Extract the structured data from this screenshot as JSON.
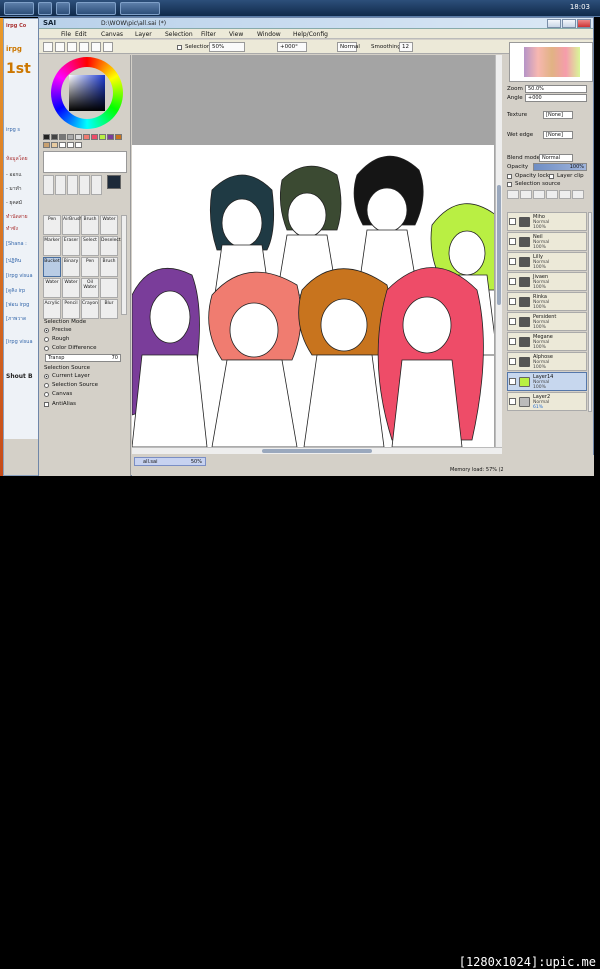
{
  "taskbar": {
    "clock": "18:03"
  },
  "background_window": {
    "lines": [
      "irpg Co",
      "irpg",
      "1st",
      "irpg s",
      "ห้อมูลโดย",
      "- ออกแ",
      "- มาทำ",
      "- ยุคสมั",
      "ทำนัดสาย",
      "ทำซัง",
      "[Shana :",
      "[ปฏิทิน",
      "[irpg visua",
      "[ดูคิง irp",
      "[ฟอน irpg",
      "[ภาพวาด",
      "[irpg visua",
      "Shout B"
    ]
  },
  "app": {
    "logo": "SAI",
    "title_path": "D:\\WOW\\pic\\all.sai (*)",
    "menus": [
      "File",
      "Edit",
      "Canvas",
      "Layer",
      "Selection",
      "Filter",
      "View",
      "Window",
      "Help/Config"
    ]
  },
  "toolbar": {
    "selection_label": "Selection",
    "zoom": "50%",
    "angle": "+000°",
    "mode": "Normal",
    "smoothing_label": "Smoothing",
    "smoothing_value": "12"
  },
  "tools": {
    "row1": [
      "Pen",
      "AirBrush",
      "Brush",
      "Water"
    ],
    "row2": [
      "Marker",
      "Eraser",
      "Select",
      "Deselect"
    ],
    "row3": [
      "Bucket",
      "Binary",
      "Pen",
      "Brush"
    ],
    "row4": [
      "Water",
      "Water",
      "Oil Water",
      ""
    ],
    "row5": [
      "Acrylic",
      "Pencil",
      "Crayon",
      "Blur"
    ]
  },
  "left_panel": {
    "selection_mode_label": "Selection Mode",
    "modes": [
      "Precise",
      "Rough",
      "Color Difference"
    ],
    "transp_label": "Transp",
    "transp_value": "70",
    "selection_source_label": "Selection Source",
    "sources": [
      "Current Layer",
      "Selection Source",
      "Canvas"
    ],
    "antialias": "AntiAlias"
  },
  "right_panel": {
    "zoom_label": "Zoom",
    "zoom_value": "50.0%",
    "angle_label": "Angle",
    "angle_value": "+000",
    "texture_label": "Texture",
    "texture_value": "[None]",
    "wet_edge_label": "Wet edge",
    "wet_edge_value": "[None]",
    "blend_label": "Blend mode",
    "blend_value": "Normal",
    "opacity_label": "Opacity",
    "opacity_value": "100%",
    "opacity_lock": "Opacity lock",
    "layer_clip": "Layer clip",
    "selection_source": "Selection source"
  },
  "layers": [
    {
      "name": "Miho",
      "mode": "Normal",
      "opacity": "100%"
    },
    {
      "name": "Neil",
      "mode": "Normal",
      "opacity": "100%"
    },
    {
      "name": "Lilly",
      "mode": "Normal",
      "opacity": "100%"
    },
    {
      "name": "Jivaen",
      "mode": "Normal",
      "opacity": "100%"
    },
    {
      "name": "Rinka",
      "mode": "Normal",
      "opacity": "100%"
    },
    {
      "name": "Persident",
      "mode": "Normal",
      "opacity": "100%"
    },
    {
      "name": "Megane",
      "mode": "Normal",
      "opacity": "100%"
    },
    {
      "name": "Alphose",
      "mode": "Normal",
      "opacity": "100%"
    },
    {
      "name": "Layer14",
      "mode": "Normal",
      "opacity": "100%"
    },
    {
      "name": "Layer2",
      "mode": "Normal",
      "opacity": "61%"
    }
  ],
  "status": {
    "tab": "all.sai",
    "tab_zoom": "50%",
    "memory": "Memory load: 57% (205MB / 826MB)",
    "keys": "Shift Ctrl Alt SPC"
  },
  "watermark": "[1280x1024]:upic.me",
  "colors": {
    "purple_hair": "#7a3d9a",
    "salmon_hair": "#f07c70",
    "orange_hair": "#c8741e",
    "pink_hair": "#ee4c68",
    "green_hair": "#b9ef43",
    "dark_teal_hair": "#1f3a44",
    "dark_green_hair": "#3b4a32",
    "black_hair": "#151515"
  }
}
